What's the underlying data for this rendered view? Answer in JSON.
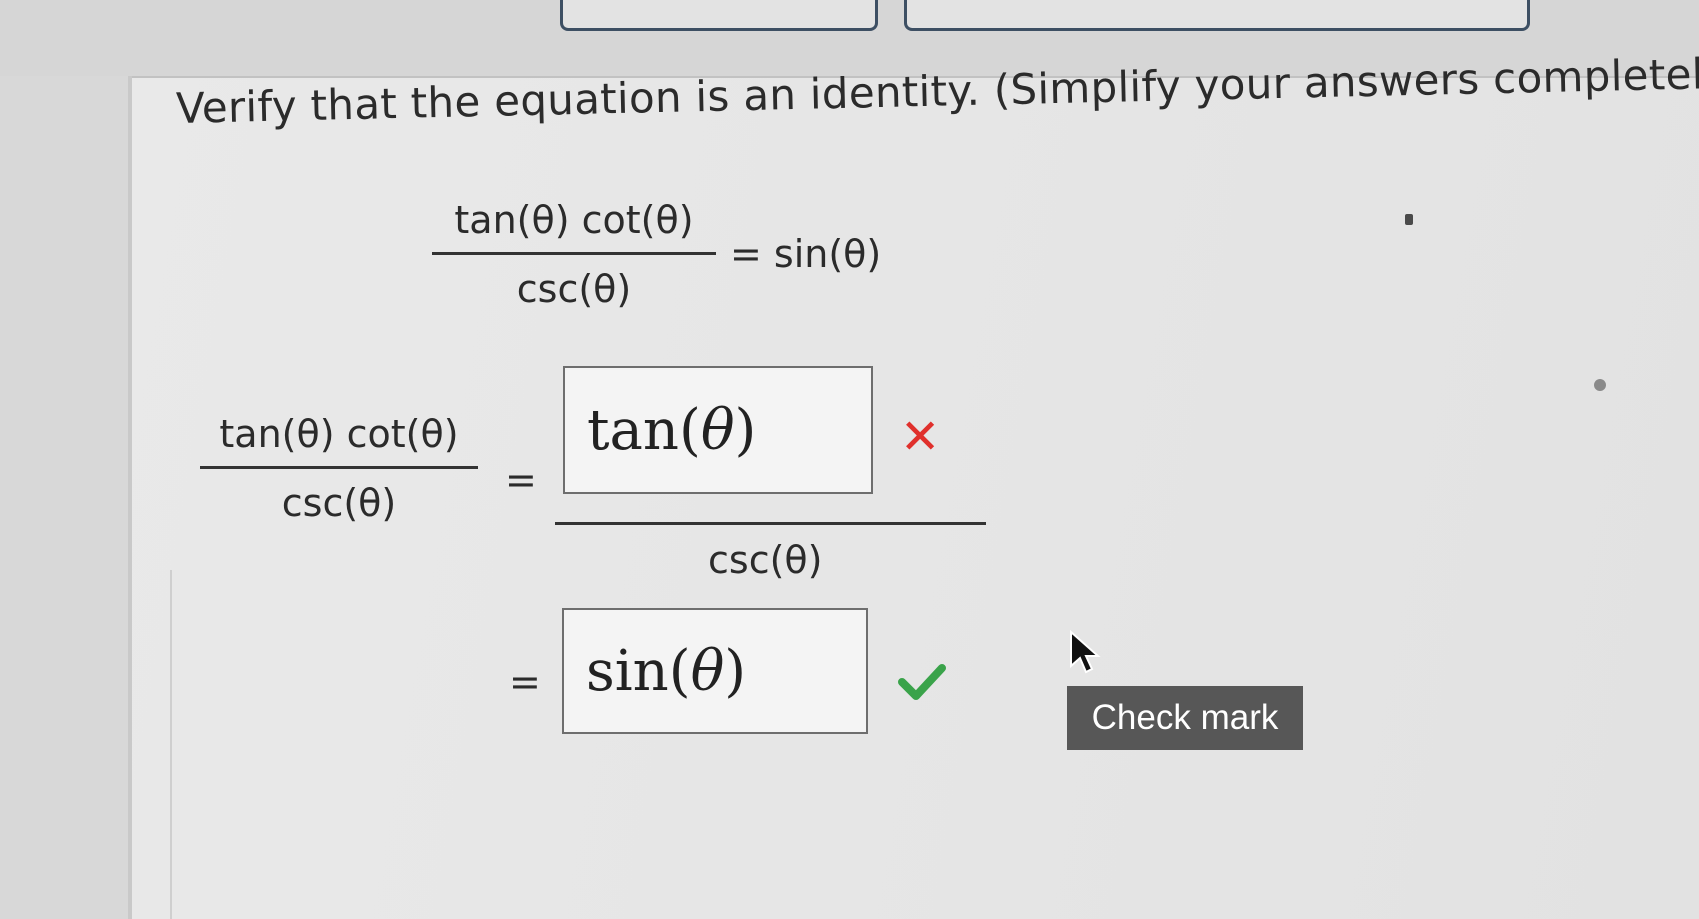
{
  "question": "Verify that the equation is an identity. (Simplify your answers completely",
  "given": {
    "numerator": "tan(θ) cot(θ)",
    "denominator": "csc(θ)",
    "rhs": "= sin(θ)"
  },
  "step1": {
    "lhs_numerator": "tan(θ) cot(θ)",
    "lhs_denominator": "csc(θ)",
    "equals": "=",
    "answer_func": "tan",
    "answer_arg": "θ",
    "result_mark": "✕",
    "rhs_denominator": "csc(θ)"
  },
  "step2": {
    "equals": "=",
    "answer_func": "sin",
    "answer_arg": "θ"
  },
  "tooltip": "Check mark",
  "colors": {
    "incorrect": "#e0302c",
    "correct": "#3aa34a",
    "tooltip_bg": "#575757"
  }
}
